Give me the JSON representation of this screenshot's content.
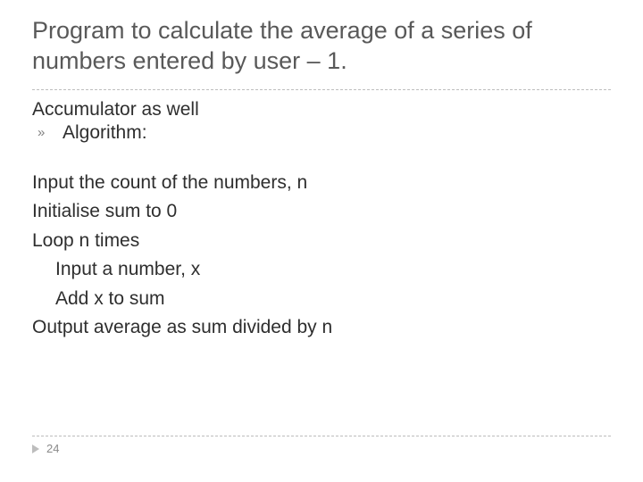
{
  "title": "Program to calculate the average of a series of numbers entered by user – 1.",
  "intro_line": "Accumulator as well",
  "bullet_label": "Algorithm:",
  "algorithm": {
    "l1": "Input the count of the numbers, n",
    "l2": "Initialise sum to 0",
    "l3": "Loop n times",
    "l4": "Input a number, x",
    "l5": "Add x to sum",
    "l6": "Output average as sum divided by n"
  },
  "page_number": "24"
}
